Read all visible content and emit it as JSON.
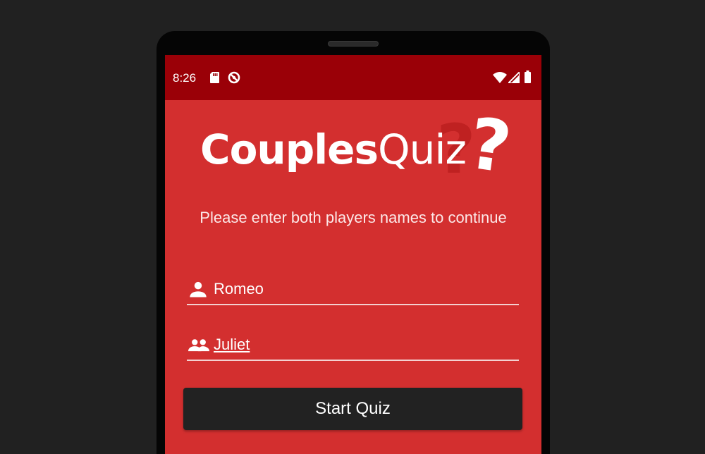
{
  "status_bar": {
    "time": "8:26",
    "icons": [
      "sd-card-icon",
      "data-saver-icon",
      "wifi-icon",
      "signal-icon",
      "battery-icon"
    ]
  },
  "logo": {
    "bold_part": "Couples",
    "light_part": "Quiz",
    "mark": "?"
  },
  "prompt": {
    "text": "Please enter both players names to continue"
  },
  "fields": {
    "player1": {
      "value": "Romeo",
      "icon": "person-icon"
    },
    "player2": {
      "value": "Juliet",
      "icon": "people-icon"
    }
  },
  "start_button": {
    "label": "Start Quiz"
  },
  "colors": {
    "background": "#212121",
    "status_bar": "#9a0007",
    "screen": "#d32f2f",
    "button": "#222222",
    "text": "#ffffff"
  }
}
